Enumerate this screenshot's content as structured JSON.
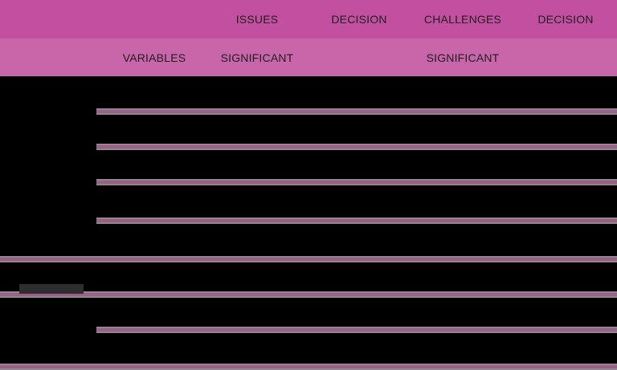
{
  "header": {
    "row1": {
      "col_issues": "ISSUES",
      "col_decision_1": "DECISION",
      "col_challenges": "CHALLENGES",
      "col_decision_2": "DECISION"
    },
    "row2": {
      "col_variables": "VARIABLES",
      "col_significant_1": "SIGNIFICANT",
      "col_significant_2": "SIGNIFICANT"
    }
  },
  "colors": {
    "header_row_1": "#c24f9f",
    "header_row_2": "#c966aa",
    "body_background": "#000000",
    "rule_magenta": "#a35b8e",
    "rule_gray": "#8a8a8a"
  }
}
